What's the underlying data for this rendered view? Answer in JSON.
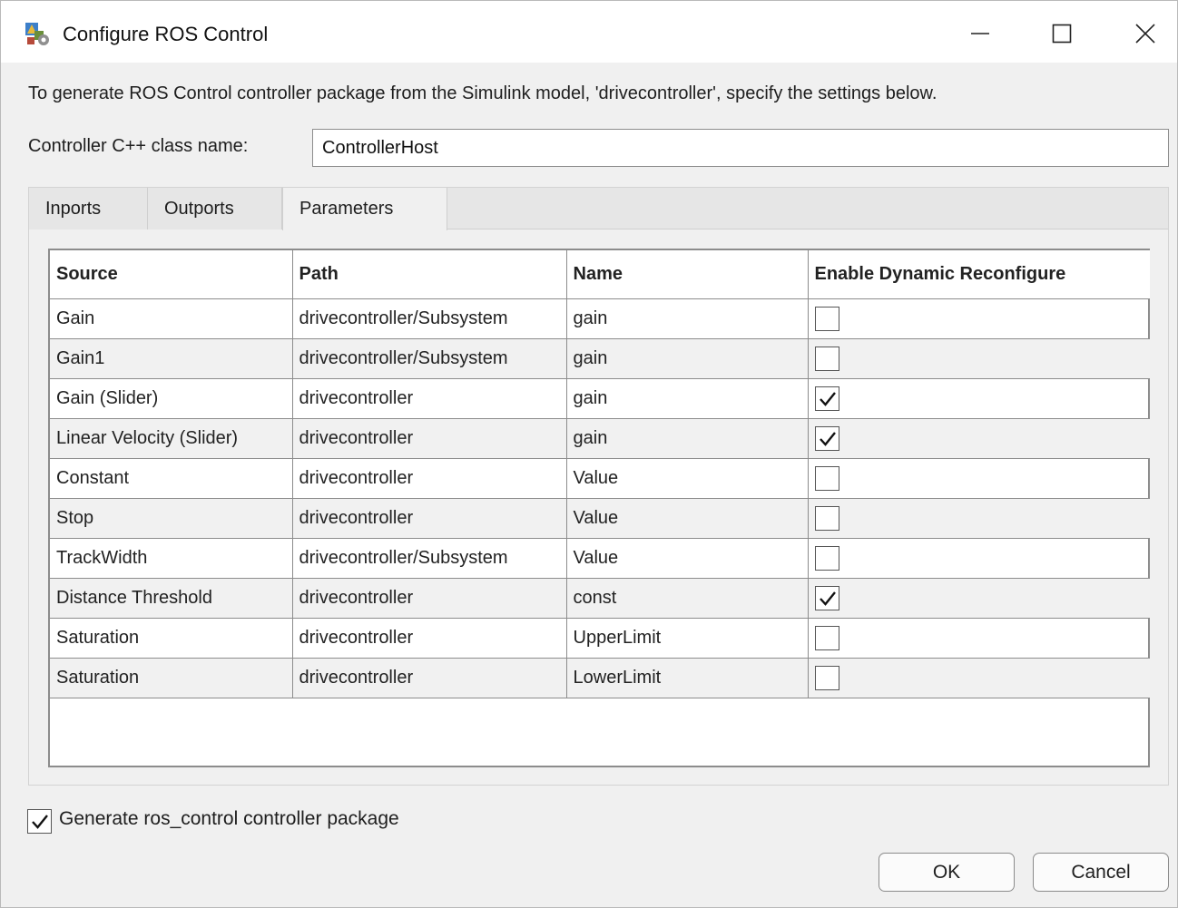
{
  "window": {
    "title": "Configure ROS Control",
    "icon": "ros-control-app-icon",
    "controls": [
      "minimize-icon",
      "maximize-icon",
      "close-icon"
    ]
  },
  "instructions": "To generate ROS Control controller package from the Simulink model, 'drivecontroller', specify the settings below.",
  "class_name": {
    "label": "Controller C++ class name:",
    "value": "ControllerHost"
  },
  "tabs": [
    {
      "label": "Inports",
      "active": false
    },
    {
      "label": "Outports",
      "active": false
    },
    {
      "label": "Parameters",
      "active": true
    }
  ],
  "table": {
    "columns": [
      "Source",
      "Path",
      "Name",
      "Enable Dynamic Reconfigure"
    ],
    "rows": [
      {
        "source": "Gain",
        "path": "drivecontroller/Subsystem",
        "name": "gain",
        "enabled": false
      },
      {
        "source": "Gain1",
        "path": "drivecontroller/Subsystem",
        "name": "gain",
        "enabled": false
      },
      {
        "source": "Gain (Slider)",
        "path": "drivecontroller",
        "name": "gain",
        "enabled": true
      },
      {
        "source": "Linear Velocity (Slider)",
        "path": "drivecontroller",
        "name": "gain",
        "enabled": true
      },
      {
        "source": "Constant",
        "path": "drivecontroller",
        "name": "Value",
        "enabled": false
      },
      {
        "source": "Stop",
        "path": "drivecontroller",
        "name": "Value",
        "enabled": false
      },
      {
        "source": "TrackWidth",
        "path": "drivecontroller/Subsystem",
        "name": "Value",
        "enabled": false
      },
      {
        "source": "Distance Threshold",
        "path": "drivecontroller",
        "name": "const",
        "enabled": true
      },
      {
        "source": "Saturation",
        "path": "drivecontroller",
        "name": "UpperLimit",
        "enabled": false
      },
      {
        "source": "Saturation",
        "path": "drivecontroller",
        "name": "LowerLimit",
        "enabled": false
      }
    ]
  },
  "generate_package": {
    "label": "Generate ros_control controller package",
    "checked": true
  },
  "buttons": {
    "ok": "OK",
    "cancel": "Cancel"
  }
}
